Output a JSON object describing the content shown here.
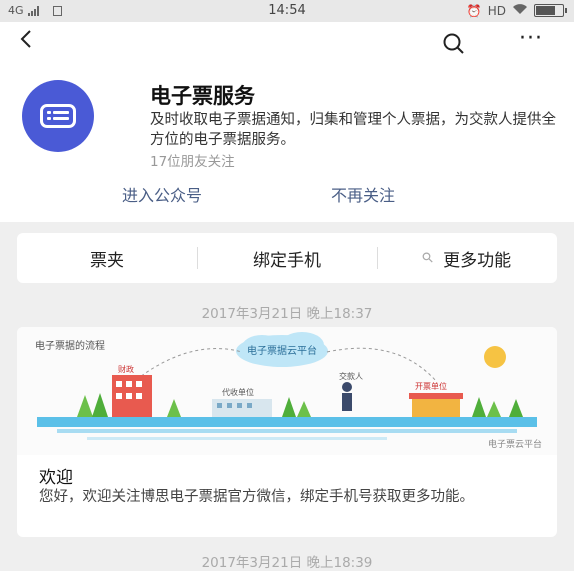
{
  "status_bar": {
    "network": "4G",
    "time": "14:54",
    "hd": "HD",
    "battery_level": 0.8
  },
  "nav": {
    "back_icon": "back-arrow-icon",
    "search_icon": "search-icon",
    "more_icon": "more-icon",
    "more_glyph": "···"
  },
  "account": {
    "avatar_icon": "ticket-icon",
    "avatar_color": "#4a5ad6",
    "name": "电子票服务",
    "description": "及时收取电子票据通知，归集和管理个人票据，为交款人提供全方位的电子票据服务。",
    "followers": "17位朋友关注",
    "enter_label": "进入公众号",
    "unfollow_label": "不再关注",
    "link_color": "#4a5e86"
  },
  "menu": {
    "items": [
      {
        "label": "票夹"
      },
      {
        "label": "绑定手机"
      },
      {
        "label": "更多功能",
        "icon": "link-icon"
      }
    ]
  },
  "messages": [
    {
      "time": "2017年3月21日 晚上18:37",
      "cover_caption": "电子票据的流程",
      "cover_cloud_label": "电子票据云平台",
      "cover_source": "电子票云平台",
      "cover_payer_label": "交款人",
      "cover_unit_label": "开票单位",
      "cover_finance_label": "财政",
      "cover_collect_label": "代收单位",
      "title": "欢迎",
      "body": "您好，欢迎关注博思电子票据官方微信，绑定手机号获取更多功能。"
    },
    {
      "time": "2017年3月21日 晚上18:39"
    }
  ]
}
